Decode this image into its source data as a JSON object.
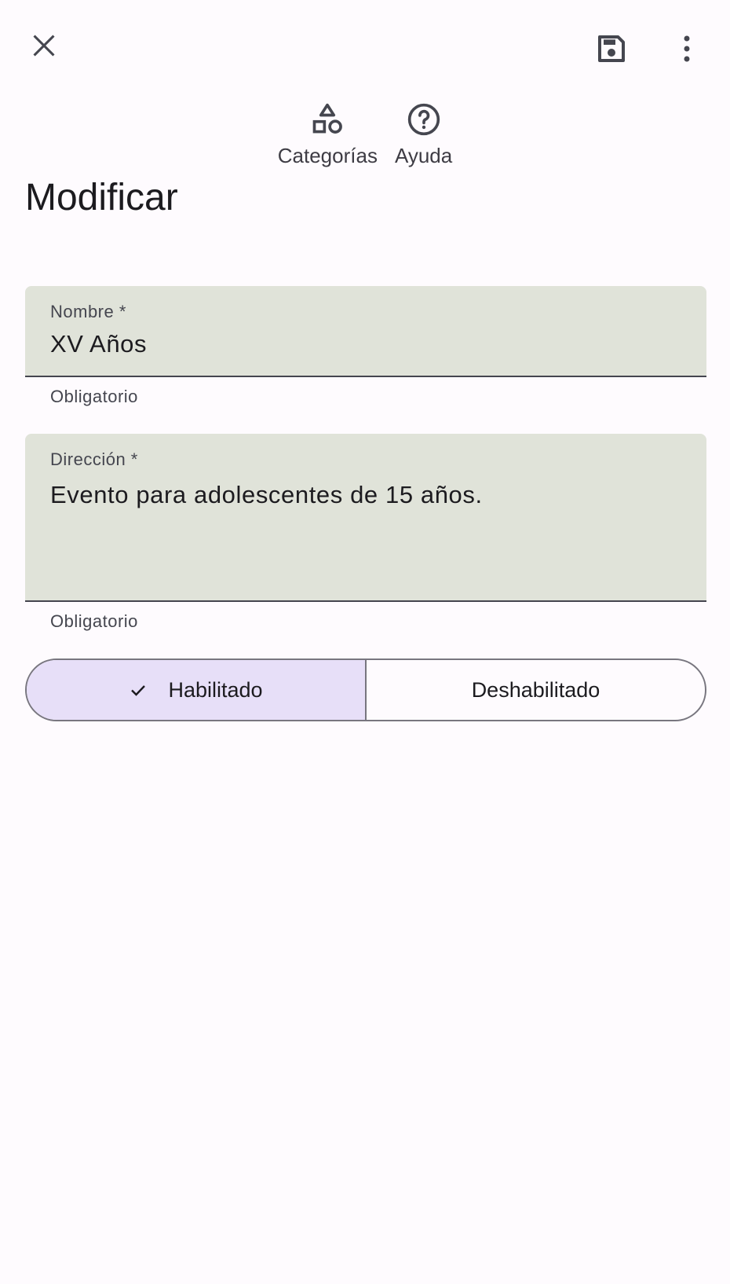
{
  "toolbar": {
    "close_icon": "close-icon",
    "save_icon": "save-icon",
    "more_icon": "more-vert-icon"
  },
  "actions": {
    "categories_label": "Categorías",
    "help_label": "Ayuda"
  },
  "page": {
    "title": "Modificar"
  },
  "form": {
    "name": {
      "label": "Nombre *",
      "value": "XV Años",
      "helper": "Obligatorio"
    },
    "direction": {
      "label": "Dirección *",
      "value": "Evento para adolescentes de 15 años.",
      "helper": "Obligatorio"
    }
  },
  "status": {
    "enabled_label": "Habilitado",
    "disabled_label": "Deshabilitado",
    "selected": "enabled"
  },
  "colors": {
    "background": "#fefbfe",
    "field_fill": "#e0e3d9",
    "selected_segment": "#e7dff8",
    "icon": "#45464f"
  }
}
